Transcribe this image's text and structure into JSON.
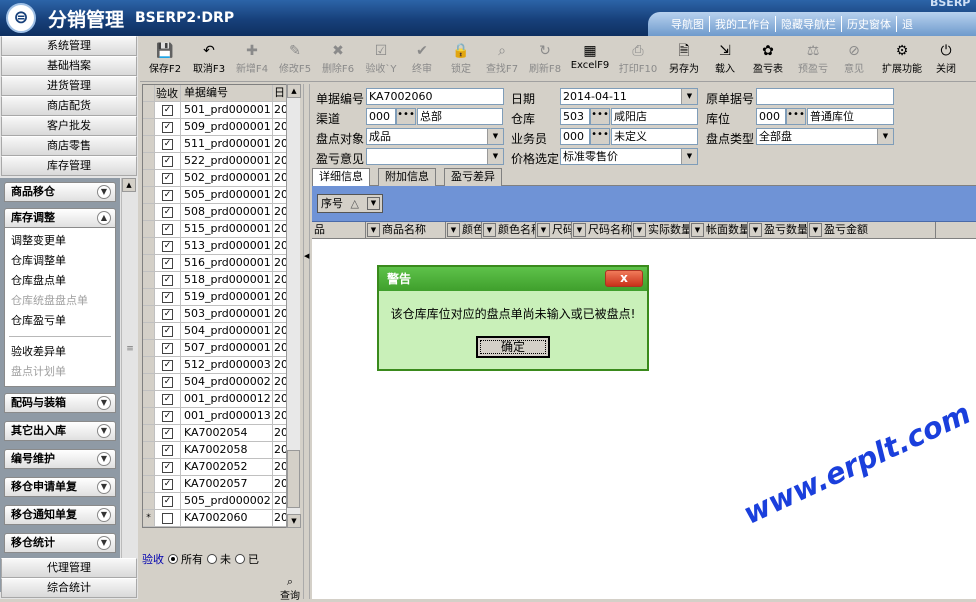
{
  "header": {
    "title": "分销管理",
    "subtitle": "BSERP2·DRP",
    "corner_brand": "BSERP",
    "nav": [
      "导航图",
      "我的工作台",
      "隐藏导航栏",
      "历史窗体",
      "退"
    ]
  },
  "sidebar": {
    "top_menu": [
      "系统管理",
      "基础档案",
      "进货管理",
      "商店配货",
      "客户批发",
      "商店零售",
      "库存管理"
    ],
    "groups": [
      {
        "title": "商品移仓",
        "expanded": false,
        "items": []
      },
      {
        "title": "库存调整",
        "expanded": true,
        "items": [
          {
            "label": "调整变更单",
            "enabled": true
          },
          {
            "label": "仓库调整单",
            "enabled": true
          },
          {
            "label": "仓库盘点单",
            "enabled": true
          },
          {
            "label": "仓库统盘盘点单",
            "enabled": false
          },
          {
            "label": "仓库盈亏单",
            "enabled": true
          },
          {
            "label": "验收差异单",
            "enabled": true
          },
          {
            "label": "盘点计划单",
            "enabled": false
          }
        ]
      },
      {
        "title": "配码与装箱",
        "expanded": false,
        "items": []
      },
      {
        "title": "其它出入库",
        "expanded": false,
        "items": []
      },
      {
        "title": "编号维护",
        "expanded": false,
        "items": []
      },
      {
        "title": "移仓申请单复",
        "expanded": false,
        "items": []
      },
      {
        "title": "移仓通知单复",
        "expanded": false,
        "items": []
      },
      {
        "title": "移仓统计",
        "expanded": false,
        "items": []
      }
    ],
    "bottom_menu": [
      "代理管理",
      "综合统计"
    ]
  },
  "toolbar": {
    "buttons": [
      {
        "label": "保存F2",
        "icon": "💾",
        "enabled": true
      },
      {
        "label": "取消F3",
        "icon": "↶",
        "enabled": true
      },
      {
        "label": "新增F4",
        "icon": "✚",
        "enabled": false
      },
      {
        "label": "修改F5",
        "icon": "✎",
        "enabled": false
      },
      {
        "label": "删除F6",
        "icon": "✖",
        "enabled": false
      },
      {
        "label": "验收`Y",
        "icon": "☑",
        "enabled": false
      },
      {
        "label": "终审",
        "icon": "✔",
        "enabled": false
      },
      {
        "label": "锁定",
        "icon": "🔒",
        "enabled": false
      },
      {
        "label": "查找F7",
        "icon": "⌕",
        "enabled": false
      },
      {
        "label": "刷新F8",
        "icon": "↻",
        "enabled": false
      },
      {
        "label": "ExcelF9",
        "icon": "▦",
        "enabled": true
      },
      {
        "label": "打印F10",
        "icon": "⎙",
        "enabled": false
      },
      {
        "label": "另存为",
        "icon": "🗎",
        "enabled": true
      },
      {
        "label": "载入",
        "icon": "⇲",
        "enabled": true
      },
      {
        "label": "盈亏表",
        "icon": "✿",
        "enabled": true
      },
      {
        "label": "预盈亏",
        "icon": "⚖",
        "enabled": false
      },
      {
        "label": "意见",
        "icon": "⊘",
        "enabled": false
      },
      {
        "label": "扩展功能",
        "icon": "⚙",
        "enabled": true
      },
      {
        "label": "关闭",
        "icon": "⏻",
        "enabled": true
      }
    ]
  },
  "list": {
    "headers": [
      "验收",
      "单据编号",
      "日"
    ],
    "rows": [
      {
        "checked": true,
        "code": "501_prd000001",
        "date": "20"
      },
      {
        "checked": true,
        "code": "509_prd000001",
        "date": "20"
      },
      {
        "checked": true,
        "code": "511_prd000001",
        "date": "20"
      },
      {
        "checked": true,
        "code": "522_prd000001",
        "date": "20"
      },
      {
        "checked": true,
        "code": "502_prd000001",
        "date": "20"
      },
      {
        "checked": true,
        "code": "505_prd000001",
        "date": "20"
      },
      {
        "checked": true,
        "code": "508_prd000001",
        "date": "20"
      },
      {
        "checked": true,
        "code": "515_prd000001",
        "date": "20"
      },
      {
        "checked": true,
        "code": "513_prd000001",
        "date": "20"
      },
      {
        "checked": true,
        "code": "516_prd000001",
        "date": "20"
      },
      {
        "checked": true,
        "code": "518_prd000001",
        "date": "20"
      },
      {
        "checked": true,
        "code": "519_prd000001",
        "date": "20"
      },
      {
        "checked": true,
        "code": "503_prd000001",
        "date": "20"
      },
      {
        "checked": true,
        "code": "504_prd000001",
        "date": "20"
      },
      {
        "checked": true,
        "code": "507_prd000001",
        "date": "20"
      },
      {
        "checked": true,
        "code": "512_prd000003",
        "date": "20"
      },
      {
        "checked": true,
        "code": "504_prd000002",
        "date": "20"
      },
      {
        "checked": true,
        "code": "001_prd000012",
        "date": "20"
      },
      {
        "checked": true,
        "code": "001_prd000013",
        "date": "20"
      },
      {
        "checked": true,
        "code": "KA7002054",
        "date": "20"
      },
      {
        "checked": true,
        "code": "KA7002058",
        "date": "20"
      },
      {
        "checked": true,
        "code": "KA7002052",
        "date": "20"
      },
      {
        "checked": true,
        "code": "KA7002057",
        "date": "20"
      },
      {
        "checked": true,
        "code": "505_prd000002",
        "date": "20"
      },
      {
        "checked": false,
        "code": "KA7002060",
        "date": "20",
        "marker": "*"
      }
    ],
    "filter": {
      "label": "验收",
      "options": [
        "所有",
        "未",
        "已"
      ],
      "selected": "所有"
    },
    "query_label": "查询"
  },
  "form": {
    "doc_no": {
      "label": "单据编号",
      "value": "KA7002060"
    },
    "date": {
      "label": "日期",
      "value": "2014-04-11"
    },
    "orig_no": {
      "label": "原单据号",
      "value": ""
    },
    "channel": {
      "label": "渠道",
      "code": "000",
      "name": "总部"
    },
    "warehouse": {
      "label": "仓库",
      "code": "503",
      "name": "咸阳店"
    },
    "location": {
      "label": "库位",
      "code": "000",
      "name": "普通库位"
    },
    "stock_target": {
      "label": "盘点对象",
      "value": "成品"
    },
    "salesman": {
      "label": "业务员",
      "code": "000",
      "name": "未定义"
    },
    "stock_type": {
      "label": "盘点类型",
      "value": "全部盘"
    },
    "opinion": {
      "label": "盈亏意见",
      "value": ""
    },
    "price": {
      "label": "价格选定",
      "value": "标准零售价"
    }
  },
  "tabs": [
    "详细信息",
    "附加信息",
    "盈亏差异"
  ],
  "detail": {
    "group_chip": "序号",
    "columns": [
      "品",
      "商品名称",
      "颜色",
      "颜色名称",
      "尺码",
      "尺码名称",
      "实际数量",
      "帐面数量",
      "盈亏数量",
      "盈亏金额"
    ]
  },
  "dialog": {
    "title": "警告",
    "close": "x",
    "message": "该仓库库位对应的盘点单尚未输入或已被盘点!",
    "ok": "确定"
  },
  "watermark": "www.erplt.com"
}
